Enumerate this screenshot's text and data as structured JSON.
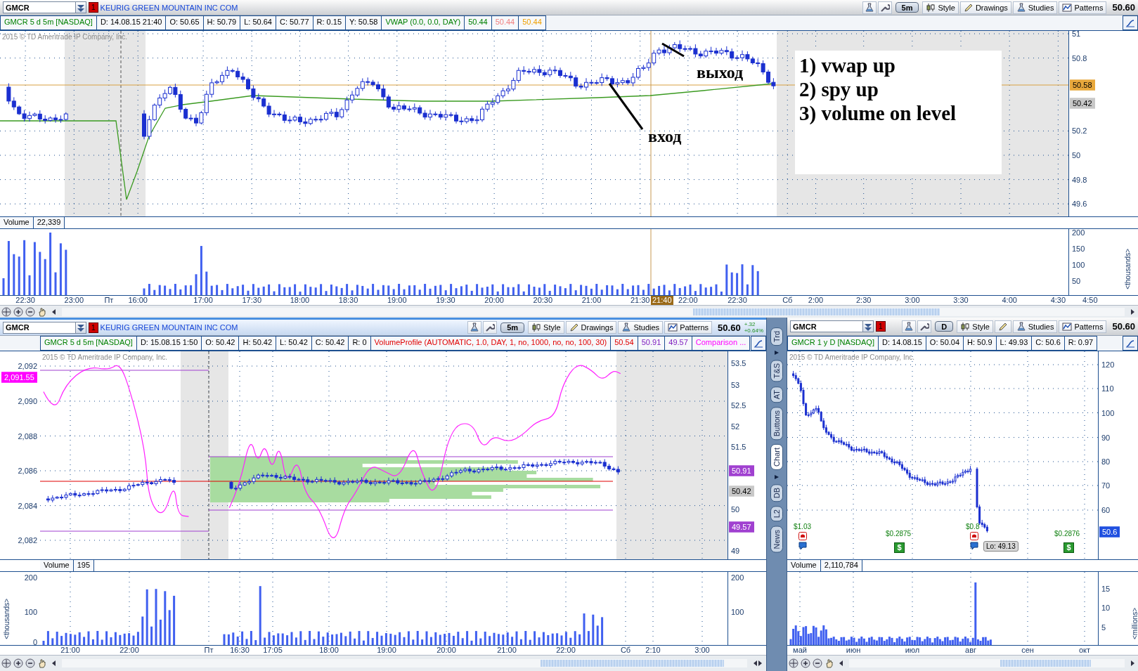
{
  "panels": [
    {
      "kind": "intraday",
      "symbol": "GMCR",
      "alerts": "1",
      "company": "KEURIG GREEN MOUNTAIN INC COM",
      "aggregation": "5m",
      "last": "50.60",
      "tools": [
        {
          "kind": "style",
          "label": "Style"
        },
        {
          "kind": "drawings",
          "label": "Drawings"
        },
        {
          "kind": "studies",
          "label": "Studies"
        },
        {
          "kind": "patterns",
          "label": "Patterns"
        }
      ],
      "info": [
        {
          "text": "GMCR 5 d 5m [NASDAQ]",
          "color": "#008000"
        },
        {
          "text": "D: 14.08.15 21:40"
        },
        {
          "text": "O: 50.65"
        },
        {
          "text": "H: 50.79"
        },
        {
          "text": "L: 50.64"
        },
        {
          "text": "C: 50.77"
        },
        {
          "text": "R: 0.15"
        },
        {
          "text": "Y: 50.58"
        },
        {
          "text": "VWAP (0.0, 0.0, DAY)",
          "color": "#008000"
        },
        {
          "text": "50.44",
          "color": "#008000"
        },
        {
          "text": "50.44",
          "color": "#f08080"
        },
        {
          "text": "50.44",
          "color": "#f0a000"
        }
      ],
      "copyright": "2015 © TD Ameritrade IP Company, Inc.",
      "right_axis": [
        "51",
        "50.8",
        "50.2",
        "50",
        "49.8",
        "49.6"
      ],
      "right_tags": [
        {
          "text": "50.58",
          "color": "#e8a83c"
        },
        {
          "text": "50.42",
          "color": "#c8c8c8"
        }
      ],
      "notes": {
        "exit": "выход",
        "entry": "вход",
        "lines": [
          "1) vwap up",
          "2) spy up",
          "3) volume on level"
        ]
      },
      "volume": {
        "label": "Volume",
        "value": "22,339",
        "right_axis": [
          "200",
          "150",
          "100",
          "50"
        ],
        "unit": "<thousands>"
      },
      "time_axis": [
        "22:30",
        "23:00",
        "Пт",
        "16:00",
        "17:00",
        "17:30",
        "18:00",
        "18:30",
        "19:00",
        "19:30",
        "20:00",
        "20:30",
        "21:00",
        "21:30",
        "22:00",
        "22:30",
        "Сб",
        "2:00",
        "2:30",
        "3:00",
        "3:30",
        "4:00",
        "4:30",
        "4:50"
      ],
      "cursor_time": "21:40"
    },
    {
      "kind": "compare",
      "symbol": "GMCR",
      "alerts": "1",
      "company": "KEURIG GREEN MOUNTAIN INC COM",
      "aggregation": "5m",
      "last": "50.60",
      "change": [
        "+.32",
        "+0.64%"
      ],
      "tools": [
        {
          "kind": "style",
          "label": "Style"
        },
        {
          "kind": "drawings",
          "label": "Drawings"
        },
        {
          "kind": "studies",
          "label": "Studies"
        },
        {
          "kind": "patterns",
          "label": "Patterns"
        }
      ],
      "info": [
        {
          "text": "GMCR 5 d 5m [NASDAQ]",
          "color": "#008000"
        },
        {
          "text": "D: 15.08.15 1:50"
        },
        {
          "text": "O: 50.42"
        },
        {
          "text": "H: 50.42"
        },
        {
          "text": "L: 50.42"
        },
        {
          "text": "C: 50.42"
        },
        {
          "text": "R: 0"
        },
        {
          "text": "VolumeProfile (AUTOMATIC, 1.0, DAY, 1, no, 1000, no, no, 100, 30)",
          "color": "#e00000"
        },
        {
          "text": "50.54",
          "color": "#e00000"
        },
        {
          "text": "50.91",
          "color": "#8020c0"
        },
        {
          "text": "49.57",
          "color": "#8020c0"
        },
        {
          "text": "Comparison ...",
          "color": "#ff00ff"
        }
      ],
      "copyright": "2015 © TD Ameritrade IP Company, Inc.",
      "left_axis": [
        "2,092",
        "2,090",
        "2,088",
        "2,086",
        "2,084",
        "2,082"
      ],
      "left_tags": [
        {
          "text": "2,091.55",
          "color": "#ff00ff"
        }
      ],
      "right_axis": [
        "53.5",
        "53",
        "52.5",
        "52",
        "51.5",
        "50",
        "49"
      ],
      "right_tags": [
        {
          "text": "50.91",
          "color": "#a040d0"
        },
        {
          "text": "50.42",
          "color": "#c8c8c8"
        },
        {
          "text": "49.57",
          "color": "#a040d0"
        }
      ],
      "volume": {
        "label": "Volume",
        "value": "195",
        "left_axis": [
          "200",
          "100",
          "0"
        ],
        "right_axis": [
          "200",
          "100"
        ],
        "unit": "<thousands>"
      },
      "time_axis": [
        "21:00",
        "22:00",
        "Пт",
        "16:30",
        "17:05",
        "18:00",
        "19:00",
        "20:00",
        "21:00",
        "22:00",
        "Сб",
        "2:10",
        "3:00"
      ]
    },
    {
      "kind": "daily",
      "symbol": "GMCR",
      "alerts": "1",
      "aggregation": "D",
      "last": "50.60",
      "tools": [
        {
          "kind": "style",
          "label": "Style"
        },
        {
          "kind": "drawings"
        },
        {
          "kind": "studies",
          "label": "Studies"
        },
        {
          "kind": "patterns",
          "label": "Patterns"
        }
      ],
      "info": [
        {
          "text": "GMCR 1 y D [NASDAQ]",
          "color": "#008000"
        },
        {
          "text": "D: 14.08.15"
        },
        {
          "text": "O: 50.04"
        },
        {
          "text": "H: 50.9"
        },
        {
          "text": "L: 49.93"
        },
        {
          "text": "C: 50.6"
        },
        {
          "text": "R: 0.97"
        }
      ],
      "copyright": "2015 © TD Ameritrade IP Company, Inc.",
      "right_axis": [
        "120",
        "110",
        "100",
        "90",
        "80",
        "70",
        "60"
      ],
      "right_tags": [
        {
          "text": "50.6",
          "color": "#2050e0"
        }
      ],
      "events": [
        {
          "kind": "earnings",
          "text": "$1.03"
        },
        {
          "kind": "dividend",
          "text": "$0.2875",
          "badge": "$"
        },
        {
          "kind": "earnings",
          "text": "$0.8"
        },
        {
          "kind": "dividend",
          "text": "$0.2876",
          "badge": "$"
        }
      ],
      "low_label": "Lo: 49.13",
      "volume": {
        "label": "Volume",
        "value": "2,110,784",
        "right_axis": [
          "15",
          "10",
          "5"
        ],
        "unit": "<millions>"
      },
      "time_axis": [
        "май",
        "июн",
        "июл",
        "авг",
        "сен",
        "окт"
      ]
    }
  ],
  "side_tabs": [
    {
      "label": "Trd",
      "selected": false
    },
    {
      "label": "T&S",
      "selected": false
    },
    {
      "label": "AT",
      "selected": false
    },
    {
      "label": "Buttons",
      "selected": false
    },
    {
      "label": "Chart",
      "selected": true
    },
    {
      "label": "DB",
      "selected": false
    },
    {
      "label": "L2",
      "selected": false
    },
    {
      "label": "News",
      "selected": false
    }
  ]
}
